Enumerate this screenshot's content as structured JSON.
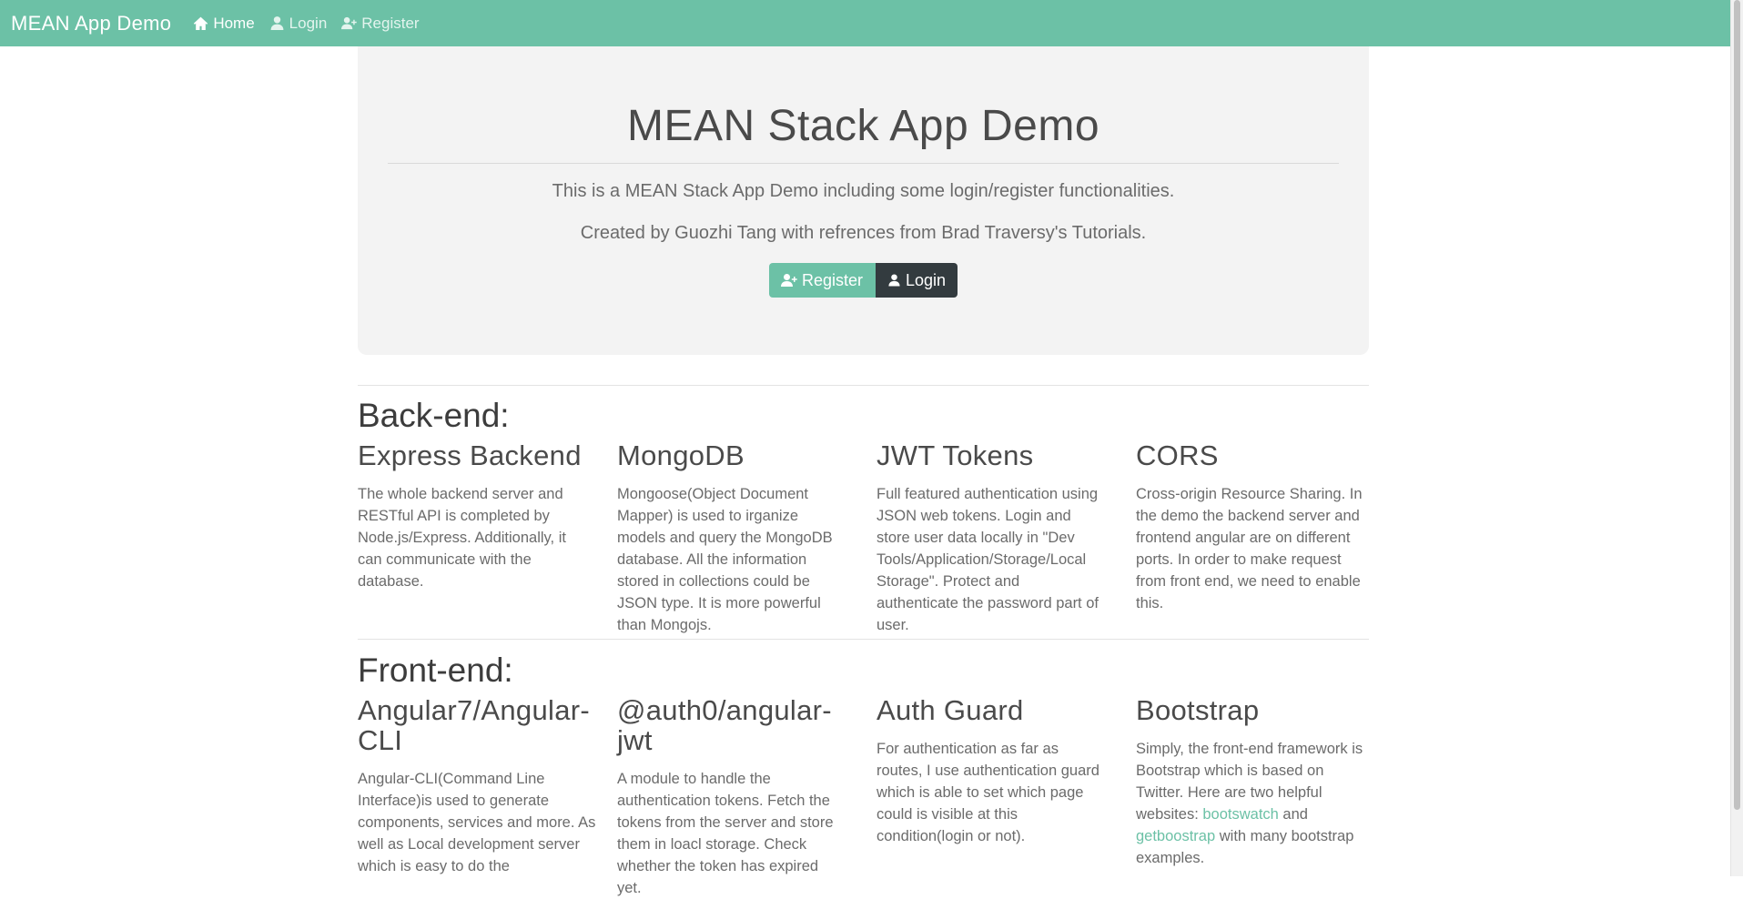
{
  "navbar": {
    "brand": "MEAN App Demo",
    "items": [
      {
        "label": "Home",
        "icon": "home-icon"
      },
      {
        "label": "Login",
        "icon": "user-icon"
      },
      {
        "label": "Register",
        "icon": "user-plus-icon"
      }
    ]
  },
  "jumbotron": {
    "title": "MEAN Stack App Demo",
    "line1": "This is a MEAN Stack App Demo including some login/register functionalities.",
    "line2": "Created by Guozhi Tang with refrences from Brad Traversy's Tutorials.",
    "register_label": "Register",
    "login_label": "Login"
  },
  "backend": {
    "title": "Back-end:",
    "cards": [
      {
        "heading": "Express Backend",
        "text": "The whole backend server and RESTful API is completed by Node.js/Express. Additionally, it can communicate with the database."
      },
      {
        "heading": "MongoDB",
        "text": "Mongoose(Object Document Mapper) is used to irganize models and query the MongoDB database. All the information stored in collections could be JSON type. It is more powerful than Mongojs."
      },
      {
        "heading": "JWT Tokens",
        "text": "Full featured authentication using JSON web tokens. Login and store user data locally in \"Dev Tools/Application/Storage/Local Storage\". Protect and authenticate the password part of user."
      },
      {
        "heading": "CORS",
        "text": "Cross-origin Resource Sharing. In the demo the backend server and frontend angular are on different ports. In order to make request from front end, we need to enable this."
      }
    ]
  },
  "frontend": {
    "title": "Front-end:",
    "cards": [
      {
        "heading": "Angular7/Angular-CLI",
        "text": "Angular-CLI(Command Line Interface)is used to generate components, services and more. As well as Local development server which is easy to do the"
      },
      {
        "heading": "@auth0/angular-jwt",
        "text": "A module to handle the authentication tokens. Fetch the tokens from the server and store them in loacl storage. Check whether the token has expired yet."
      },
      {
        "heading": "Auth Guard",
        "text": "For authentication as far as routes, I use authentication guard which is able to set which page could is visible at this condition(login or not)."
      }
    ],
    "bootstrap": {
      "heading": "Bootstrap",
      "text_before": "Simply, the front-end framework is Bootstrap which is based on Twitter. Here are two helpful websites: ",
      "link1": "bootswatch",
      "text_middle": " and ",
      "link2": "getboostrap",
      "text_after": " with many bootstrap examples."
    }
  },
  "colors": {
    "accent": "#6cc1a6",
    "dark_button": "#333b3f",
    "jumbotron_bg": "#f3f3f3"
  }
}
